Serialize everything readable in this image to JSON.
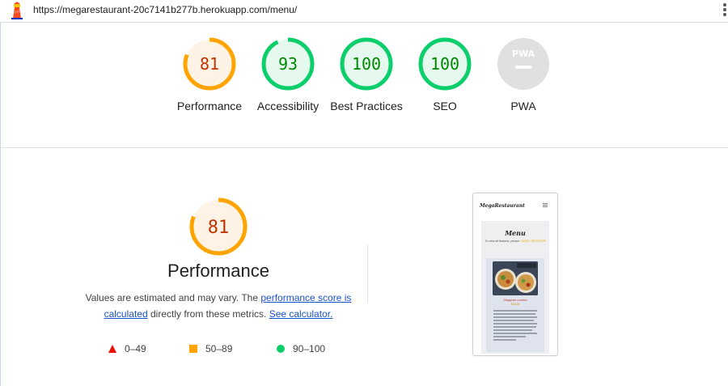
{
  "browser": {
    "url": "https://megarestaurant-20c7141b277b.herokuapp.com/menu/"
  },
  "scores": [
    {
      "label": "Performance",
      "value": "81",
      "score": 0.81,
      "status": "average"
    },
    {
      "label": "Accessibility",
      "value": "93",
      "score": 0.93,
      "status": "pass"
    },
    {
      "label": "Best Practices",
      "value": "100",
      "score": 1.0,
      "status": "pass"
    },
    {
      "label": "SEO",
      "value": "100",
      "score": 1.0,
      "status": "pass"
    },
    {
      "label": "PWA",
      "value": "",
      "score": null,
      "status": "na",
      "badge_text": "PWA"
    }
  ],
  "performance": {
    "score": "81",
    "score_fraction": 0.81,
    "title": "Performance",
    "desc_prefix": "Values are estimated and may vary. The ",
    "score_link": "performance score is calculated",
    "desc_middle": " directly from these metrics. ",
    "calculator_link": "See calculator.",
    "legend": [
      {
        "shape": "triangle",
        "range": "0–49",
        "color": "#eb0f00"
      },
      {
        "shape": "square",
        "range": "50–89",
        "color": "#ffa400"
      },
      {
        "shape": "circle",
        "range": "90–100",
        "color": "#0cce6b"
      }
    ]
  },
  "screenshot": {
    "brand": "MegaRestaurant",
    "heading": "Menu",
    "subtitle_prefix": "To view all features, please ",
    "subtitle_accent": "LOGIN / REGISTER",
    "dish_name": "Singapore noodles",
    "dish_price": "€15.00"
  },
  "colors": {
    "average_stroke": "#ffa400",
    "average_fill": "#fff3e6",
    "average_text": "#c33300",
    "pass_stroke": "#0cce6b",
    "pass_fill": "#e6f9ee",
    "pass_text": "#008800",
    "na_fill": "#e0e0e0",
    "na_text": "#ffffff"
  }
}
